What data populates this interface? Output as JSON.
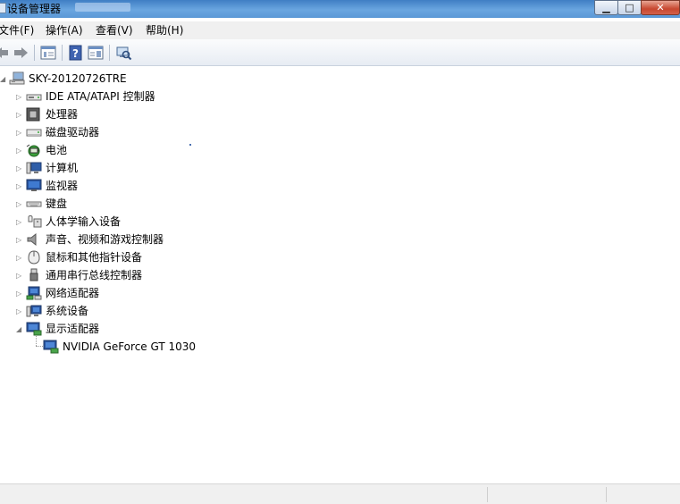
{
  "window": {
    "title": "设备管理器",
    "min_glyph": "▁",
    "max_glyph": "□",
    "close_glyph": "✕"
  },
  "menu": [
    {
      "label": "文件(F)"
    },
    {
      "label": "操作(A)"
    },
    {
      "label": "查看(V)"
    },
    {
      "label": "帮助(H)"
    }
  ],
  "toolbar": {
    "buttons": [
      "back-arrow-icon",
      "forward-arrow-icon",
      "properties-icon",
      "help-icon",
      "view-icon",
      "scan-hardware-icon"
    ]
  },
  "tree": {
    "root": {
      "label": "SKY-20120726TRE",
      "expander": "◢",
      "icon": "computer-icon"
    },
    "categories": [
      {
        "label": "IDE ATA/ATAPI 控制器",
        "icon": "ide-controller-icon",
        "expander": "▷"
      },
      {
        "label": "处理器",
        "icon": "processor-icon",
        "expander": "▷"
      },
      {
        "label": "磁盘驱动器",
        "icon": "disk-drive-icon",
        "expander": "▷"
      },
      {
        "label": "电池",
        "icon": "battery-icon",
        "expander": "▷"
      },
      {
        "label": "计算机",
        "icon": "computer-icon",
        "expander": "▷"
      },
      {
        "label": "监视器",
        "icon": "monitor-icon",
        "expander": "▷"
      },
      {
        "label": "键盘",
        "icon": "keyboard-icon",
        "expander": "▷"
      },
      {
        "label": "人体学输入设备",
        "icon": "hid-icon",
        "expander": "▷"
      },
      {
        "label": "声音、视频和游戏控制器",
        "icon": "speaker-icon",
        "expander": "▷"
      },
      {
        "label": "鼠标和其他指针设备",
        "icon": "mouse-icon",
        "expander": "▷"
      },
      {
        "label": "通用串行总线控制器",
        "icon": "usb-icon",
        "expander": "▷"
      },
      {
        "label": "网络适配器",
        "icon": "network-adapter-icon",
        "expander": "▷"
      },
      {
        "label": "系统设备",
        "icon": "system-device-icon",
        "expander": "▷"
      },
      {
        "label": "显示适配器",
        "icon": "display-adapter-icon",
        "expander": "◢"
      }
    ],
    "child": {
      "label": "NVIDIA GeForce GT 1030",
      "icon": "display-adapter-icon"
    }
  }
}
